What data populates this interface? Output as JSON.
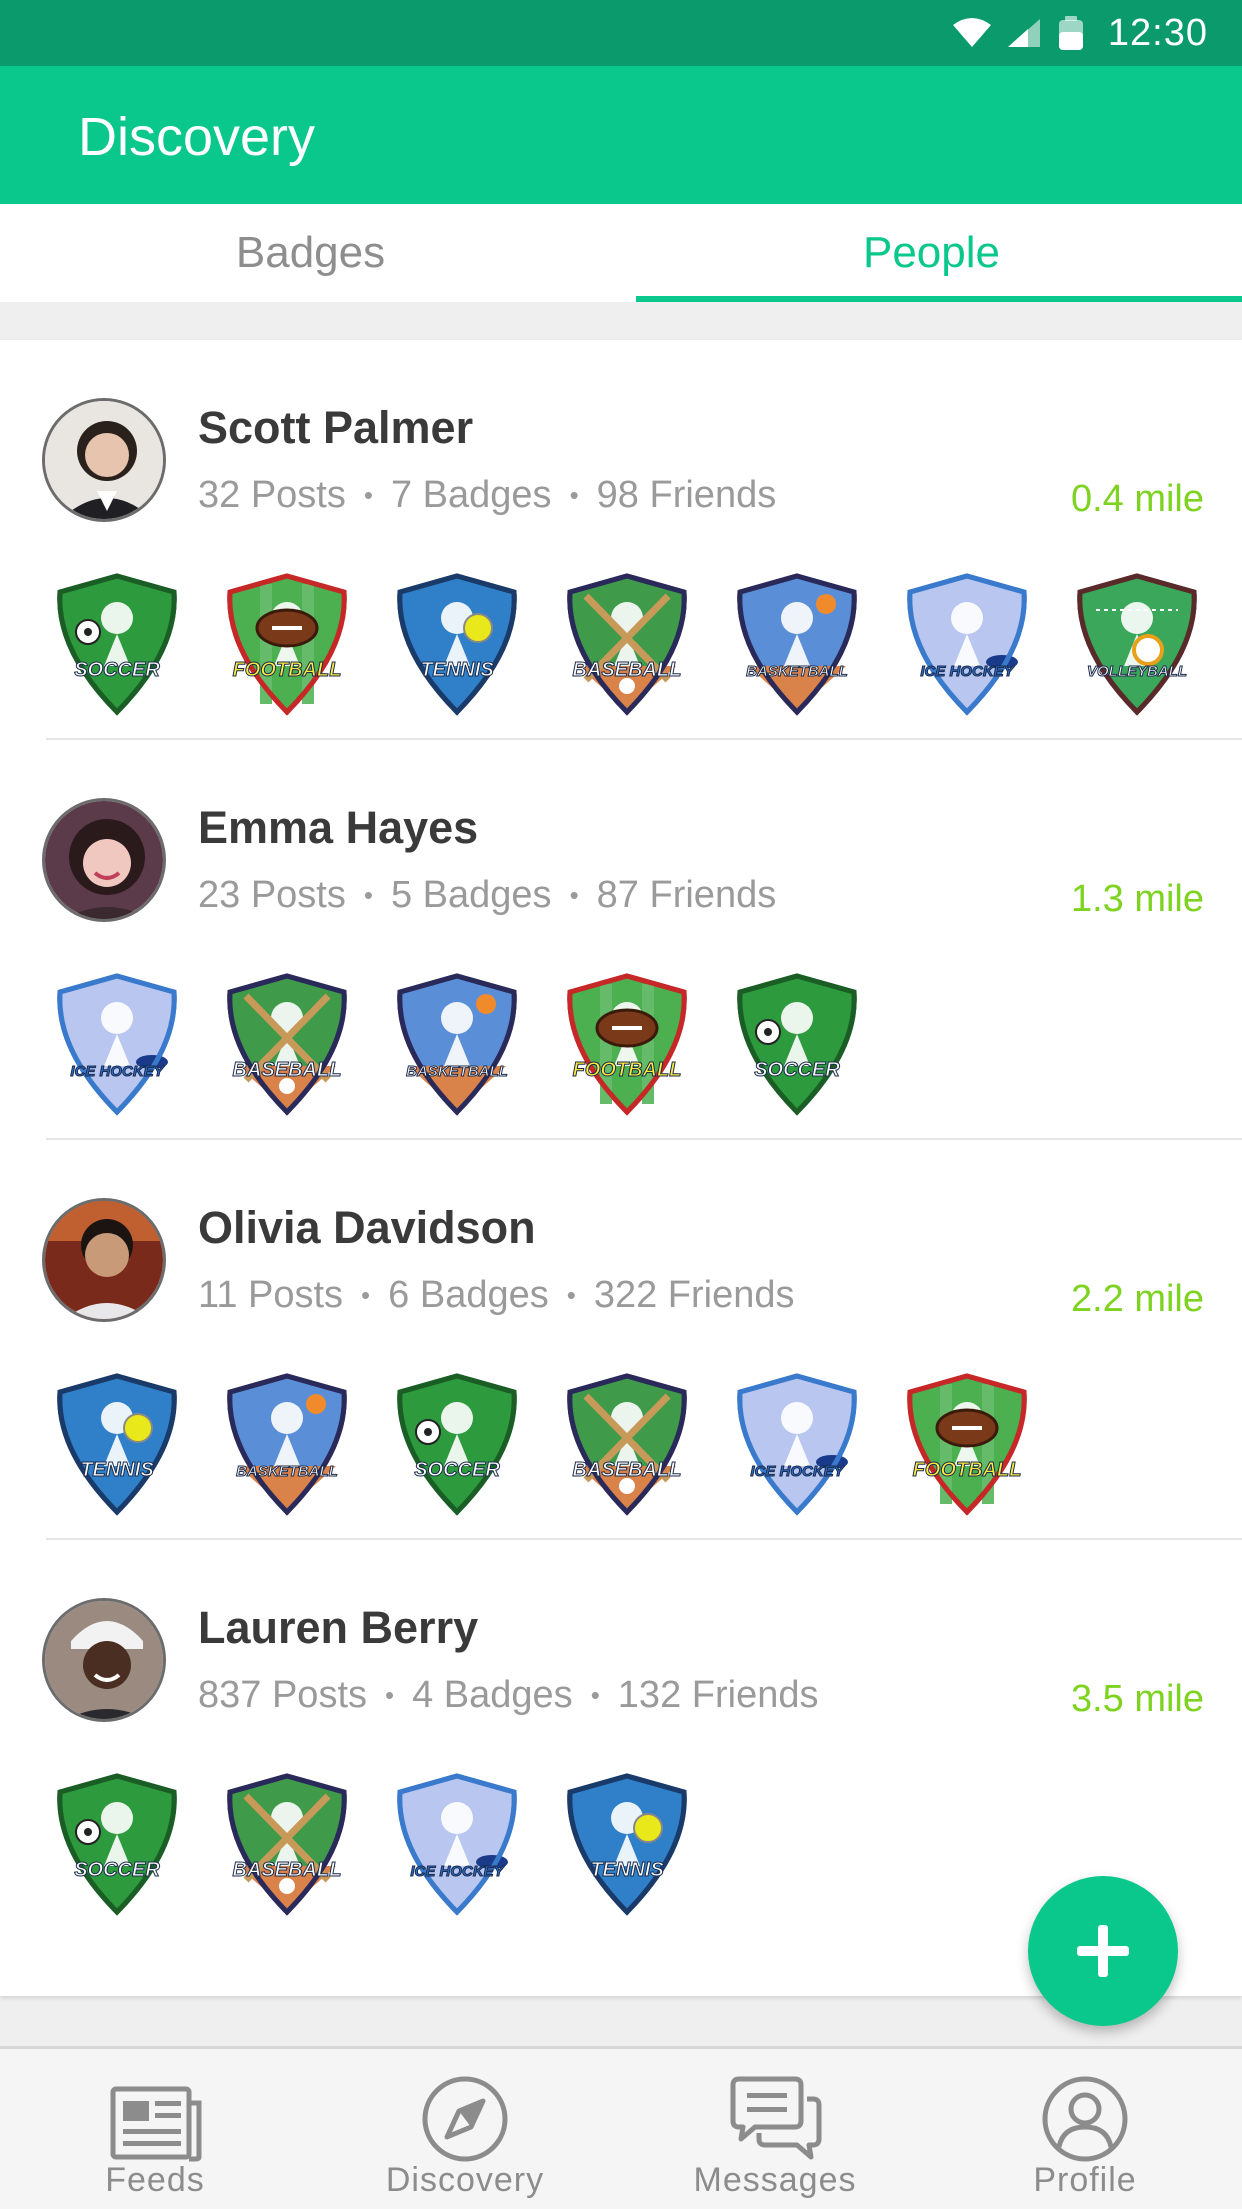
{
  "status_bar": {
    "time": "12:30",
    "icons": [
      "wifi-icon",
      "signal-icon",
      "battery-icon"
    ]
  },
  "app_bar": {
    "title": "Discovery"
  },
  "tabs": [
    {
      "label": "Badges",
      "active": false
    },
    {
      "label": "People",
      "active": true
    }
  ],
  "people": [
    {
      "name": "Scott Palmer",
      "posts": "32 Posts",
      "badges": "7 Badges",
      "friends": "98 Friends",
      "distance": "0.4 mile",
      "badge_list": [
        "SOCCER",
        "FOOTBALL",
        "TENNIS",
        "BASEBALL",
        "BASKETBALL",
        "ICE HOCKEY",
        "VOLLEYBALL"
      ]
    },
    {
      "name": "Emma Hayes",
      "posts": "23 Posts",
      "badges": "5 Badges",
      "friends": "87 Friends",
      "distance": "1.3 mile",
      "badge_list": [
        "ICE HOCKEY",
        "BASEBALL",
        "BASKETBALL",
        "FOOTBALL",
        "SOCCER"
      ]
    },
    {
      "name": "Olivia Davidson",
      "posts": "11 Posts",
      "badges": "6 Badges",
      "friends": "322 Friends",
      "distance": "2.2 mile",
      "badge_list": [
        "TENNIS",
        "BASKETBALL",
        "SOCCER",
        "BASEBALL",
        "ICE HOCKEY",
        "FOOTBALL"
      ]
    },
    {
      "name": "Lauren Berry",
      "posts": "837 Posts",
      "badges": "4 Badges",
      "friends": "132 Friends",
      "distance": "3.5 mile",
      "badge_list": [
        "SOCCER",
        "BASEBALL",
        "ICE HOCKEY",
        "TENNIS"
      ]
    }
  ],
  "fab": {
    "icon": "plus-icon"
  },
  "bottom_nav": [
    {
      "label": "Feeds",
      "icon": "newspaper-icon"
    },
    {
      "label": "Discovery",
      "icon": "compass-icon"
    },
    {
      "label": "Messages",
      "icon": "chat-icon"
    },
    {
      "label": "Profile",
      "icon": "person-icon"
    }
  ],
  "colors": {
    "status_bar": "#0a9a6c",
    "primary": "#0ac78c",
    "distance": "#7ed321",
    "text_dark": "#3a3a3a",
    "text_muted": "#9a9a9a"
  }
}
